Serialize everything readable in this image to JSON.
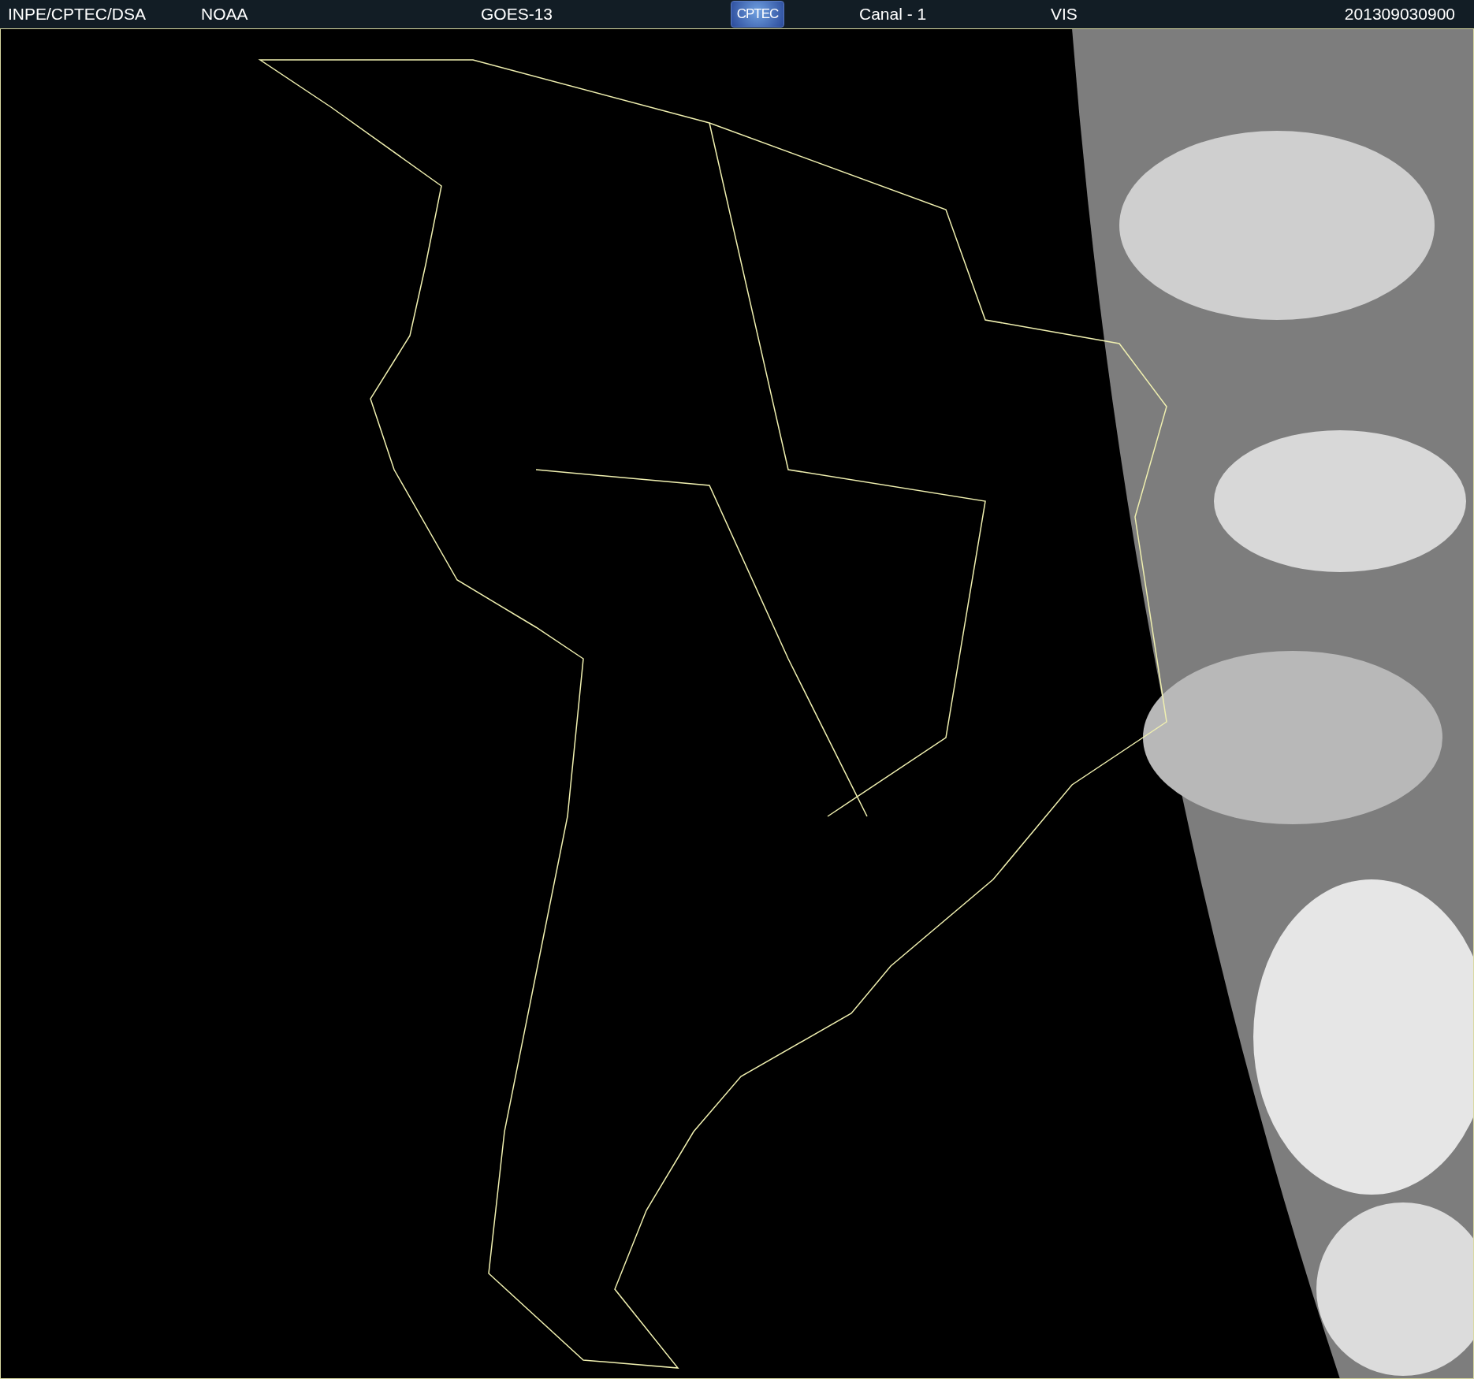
{
  "header": {
    "source": "INPE/CPTEC/DSA",
    "agency": "NOAA",
    "satellite": "GOES-13",
    "logo": "CPTEC",
    "channel": "Canal - 1",
    "band": "VIS",
    "timestamp": "201309030900"
  }
}
